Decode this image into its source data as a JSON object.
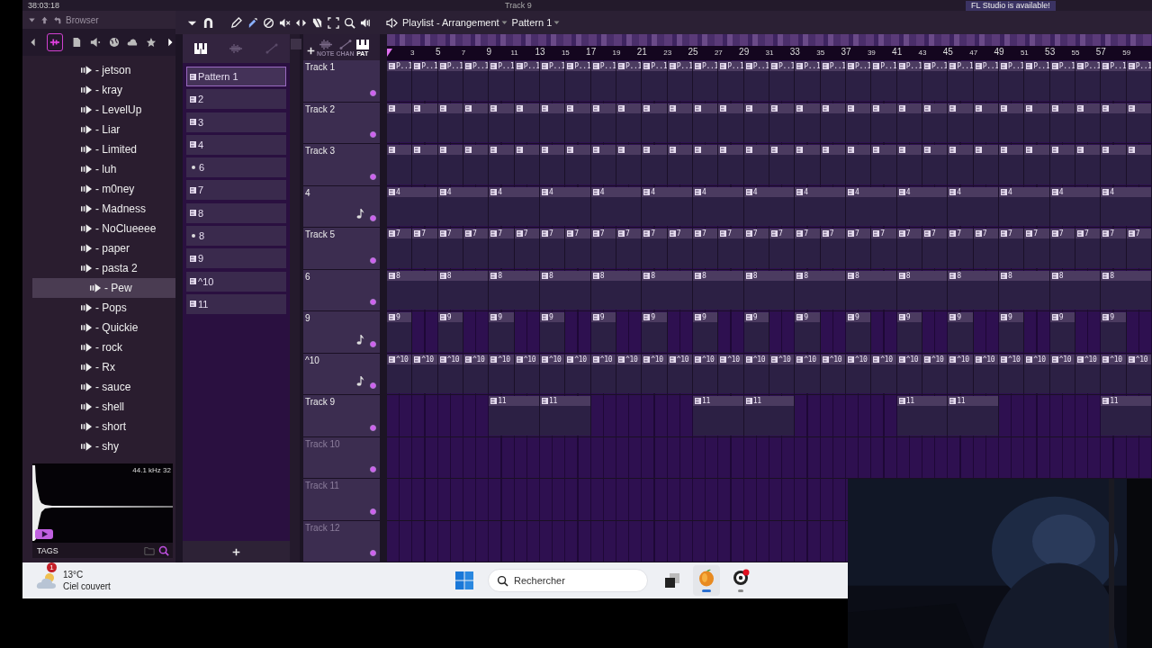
{
  "top_bar": {
    "time": "38:03:18",
    "track": "Track 9",
    "notice": "FL Studio is available!"
  },
  "browser": {
    "title": "Browser",
    "items": [
      {
        "label": "- jetson",
        "selected": false
      },
      {
        "label": "- kray",
        "selected": false
      },
      {
        "label": "- LevelUp",
        "selected": false
      },
      {
        "label": "- Liar",
        "selected": false
      },
      {
        "label": "- Limited",
        "selected": false
      },
      {
        "label": "- luh",
        "selected": false
      },
      {
        "label": "- m0ney",
        "selected": false
      },
      {
        "label": "- Madness",
        "selected": false
      },
      {
        "label": "- NoClueeee",
        "selected": false
      },
      {
        "label": "- paper",
        "selected": false
      },
      {
        "label": "- pasta 2",
        "selected": false
      },
      {
        "label": "- Pew",
        "selected": true
      },
      {
        "label": "- Pops",
        "selected": false
      },
      {
        "label": "- Quickie",
        "selected": false
      },
      {
        "label": "- rock",
        "selected": false
      },
      {
        "label": "- Rx",
        "selected": false
      },
      {
        "label": "- sauce",
        "selected": false
      },
      {
        "label": "- shell",
        "selected": false
      },
      {
        "label": "- short",
        "selected": false
      },
      {
        "label": "- shy",
        "selected": false
      }
    ],
    "preview": {
      "info": "44.1 kHz 32"
    },
    "tags_label": "TAGS"
  },
  "playlist": {
    "title": "Playlist - Arrangement",
    "pattern": "Pattern 1",
    "header_labels": [
      "NOTE",
      "CHAN",
      "PAT"
    ],
    "patterns": [
      {
        "label": "Pattern 1",
        "kind": "pattern",
        "selected": true
      },
      {
        "label": "2",
        "kind": "pattern",
        "selected": false
      },
      {
        "label": "3",
        "kind": "pattern",
        "selected": false
      },
      {
        "label": "4",
        "kind": "pattern",
        "selected": false
      },
      {
        "label": "6",
        "kind": "audio",
        "selected": false
      },
      {
        "label": "7",
        "kind": "pattern",
        "selected": false
      },
      {
        "label": "8",
        "kind": "pattern",
        "selected": false
      },
      {
        "label": "8",
        "kind": "audio",
        "selected": false
      },
      {
        "label": "9",
        "kind": "pattern",
        "selected": false
      },
      {
        "label": "^10",
        "kind": "pattern",
        "selected": false
      },
      {
        "label": "11",
        "kind": "pattern",
        "selected": false
      }
    ],
    "ruler": [
      "3",
      "5",
      "7",
      "9",
      "11",
      "13",
      "15",
      "17",
      "19",
      "21",
      "23",
      "25",
      "27",
      "29",
      "31",
      "33",
      "35",
      "37",
      "39",
      "41",
      "43",
      "45",
      "47",
      "49",
      "51",
      "53",
      "55",
      "57",
      "59"
    ],
    "tracks": [
      {
        "name": "Track 1",
        "kind": "plain",
        "dimmed": false,
        "clips": [
          {
            "kind": "pattern",
            "label": "P..1"
          },
          {
            "kind": "pattern",
            "label": "P..1"
          },
          {
            "kind": "pattern",
            "label": "P..1"
          },
          {
            "kind": "pattern",
            "label": "P..1"
          },
          {
            "kind": "pattern",
            "label": "P..1"
          },
          {
            "kind": "pattern",
            "label": "P..1"
          },
          {
            "kind": "pattern",
            "label": "P..1"
          },
          {
            "kind": "pattern",
            "label": "P..1"
          },
          {
            "kind": "pattern",
            "label": "P..1"
          },
          {
            "kind": "pattern",
            "label": "P..1"
          },
          {
            "kind": "pattern",
            "label": "P..1"
          },
          {
            "kind": "pattern",
            "label": "P..1"
          },
          {
            "kind": "pattern",
            "label": "P..1"
          },
          {
            "kind": "pattern",
            "label": "P..1"
          },
          {
            "kind": "pattern",
            "label": "P..1"
          },
          {
            "kind": "pattern",
            "label": "P..1"
          },
          {
            "kind": "pattern",
            "label": "P..1"
          },
          {
            "kind": "pattern",
            "label": "P..1"
          },
          {
            "kind": "pattern",
            "label": "P..1"
          },
          {
            "kind": "pattern",
            "label": "P..1"
          },
          {
            "kind": "pattern",
            "label": "P..1"
          },
          {
            "kind": "pattern",
            "label": "P..1"
          },
          {
            "kind": "pattern",
            "label": "P..1"
          },
          {
            "kind": "pattern",
            "label": "P..1"
          },
          {
            "kind": "pattern",
            "label": "P..1"
          },
          {
            "kind": "pattern",
            "label": "P..1"
          },
          {
            "kind": "pattern",
            "label": "P..1"
          },
          {
            "kind": "pattern",
            "label": "P..1"
          },
          {
            "kind": "pattern",
            "label": "P..1"
          },
          {
            "kind": "pattern",
            "label": "P..1"
          }
        ]
      },
      {
        "name": "Track 2",
        "kind": "plain",
        "dimmed": false,
        "clips": [
          {
            "kind": "pattern"
          },
          {
            "kind": "pattern"
          },
          {
            "kind": "pattern"
          },
          {
            "kind": "pattern"
          },
          {
            "kind": "pattern"
          },
          {
            "kind": "pattern"
          },
          {
            "kind": "pattern"
          },
          {
            "kind": "pattern"
          },
          {
            "kind": "pattern"
          },
          {
            "kind": "pattern"
          },
          {
            "kind": "pattern"
          },
          {
            "kind": "pattern"
          },
          {
            "kind": "pattern"
          },
          {
            "kind": "pattern"
          },
          {
            "kind": "pattern"
          },
          {
            "kind": "pattern"
          },
          {
            "kind": "pattern"
          },
          {
            "kind": "pattern"
          },
          {
            "kind": "pattern"
          },
          {
            "kind": "pattern"
          },
          {
            "kind": "pattern"
          },
          {
            "kind": "pattern"
          },
          {
            "kind": "pattern"
          },
          {
            "kind": "pattern"
          },
          {
            "kind": "pattern"
          },
          {
            "kind": "pattern"
          },
          {
            "kind": "pattern"
          },
          {
            "kind": "pattern"
          },
          {
            "kind": "pattern"
          },
          {
            "kind": "pattern"
          }
        ]
      },
      {
        "name": "Track 3",
        "kind": "plain",
        "dimmed": false,
        "clips": [
          {
            "kind": "pattern"
          },
          {
            "kind": "pattern"
          },
          {
            "kind": "pattern"
          },
          {
            "kind": "pattern"
          },
          {
            "kind": "pattern"
          },
          {
            "kind": "pattern"
          },
          {
            "kind": "pattern"
          },
          {
            "kind": "pattern"
          },
          {
            "kind": "pattern"
          },
          {
            "kind": "pattern"
          },
          {
            "kind": "pattern"
          },
          {
            "kind": "pattern"
          },
          {
            "kind": "pattern"
          },
          {
            "kind": "pattern"
          },
          {
            "kind": "pattern"
          },
          {
            "kind": "pattern"
          },
          {
            "kind": "pattern"
          },
          {
            "kind": "pattern"
          },
          {
            "kind": "pattern"
          },
          {
            "kind": "pattern"
          },
          {
            "kind": "pattern"
          },
          {
            "kind": "pattern"
          },
          {
            "kind": "pattern"
          },
          {
            "kind": "pattern"
          },
          {
            "kind": "pattern"
          },
          {
            "kind": "pattern"
          },
          {
            "kind": "pattern"
          },
          {
            "kind": "pattern"
          },
          {
            "kind": "pattern"
          },
          {
            "kind": "pattern"
          }
        ]
      },
      {
        "name": "4",
        "kind": "notes",
        "dimmed": false,
        "clips": [
          {
            "kind": "pattern",
            "label": "4"
          },
          {
            "kind": "pattern",
            "label": "4"
          },
          {
            "kind": "pattern",
            "label": "4"
          },
          {
            "kind": "pattern",
            "label": "4"
          },
          {
            "kind": "pattern",
            "label": "4"
          },
          {
            "kind": "pattern",
            "label": "4"
          },
          {
            "kind": "pattern",
            "label": "4"
          },
          {
            "kind": "pattern",
            "label": "4"
          },
          {
            "kind": "pattern",
            "label": "4"
          },
          {
            "kind": "pattern",
            "label": "4"
          },
          {
            "kind": "pattern",
            "label": "4"
          },
          {
            "kind": "pattern",
            "label": "4"
          },
          {
            "kind": "pattern",
            "label": "4"
          },
          {
            "kind": "pattern",
            "label": "4"
          },
          {
            "kind": "pattern",
            "label": "4"
          }
        ]
      },
      {
        "name": "Track 5",
        "kind": "plain",
        "dimmed": false,
        "clips": [
          {
            "kind": "pattern",
            "label": "7"
          },
          {
            "kind": "pattern",
            "label": "7"
          },
          {
            "kind": "pattern",
            "label": "7"
          },
          {
            "kind": "pattern",
            "label": "7"
          },
          {
            "kind": "pattern",
            "label": "7"
          },
          {
            "kind": "pattern",
            "label": "7"
          },
          {
            "kind": "pattern",
            "label": "7"
          },
          {
            "kind": "pattern",
            "label": "7"
          },
          {
            "kind": "pattern",
            "label": "7"
          },
          {
            "kind": "pattern",
            "label": "7"
          },
          {
            "kind": "pattern",
            "label": "7"
          },
          {
            "kind": "pattern",
            "label": "7"
          },
          {
            "kind": "pattern",
            "label": "7"
          },
          {
            "kind": "pattern",
            "label": "7"
          },
          {
            "kind": "pattern",
            "label": "7"
          },
          {
            "kind": "pattern",
            "label": "7"
          },
          {
            "kind": "pattern",
            "label": "7"
          },
          {
            "kind": "pattern",
            "label": "7"
          },
          {
            "kind": "pattern",
            "label": "7"
          },
          {
            "kind": "pattern",
            "label": "7"
          },
          {
            "kind": "pattern",
            "label": "7"
          },
          {
            "kind": "pattern",
            "label": "7"
          },
          {
            "kind": "pattern",
            "label": "7"
          },
          {
            "kind": "pattern",
            "label": "7"
          },
          {
            "kind": "pattern",
            "label": "7"
          },
          {
            "kind": "pattern",
            "label": "7"
          },
          {
            "kind": "pattern",
            "label": "7"
          },
          {
            "kind": "pattern",
            "label": "7"
          },
          {
            "kind": "pattern",
            "label": "7"
          },
          {
            "kind": "pattern",
            "label": "7"
          }
        ]
      },
      {
        "name": "6",
        "kind": "plain",
        "dimmed": false,
        "clips": [
          {
            "kind": "pattern",
            "label": "8"
          },
          {
            "kind": "pattern",
            "label": "8"
          },
          {
            "kind": "pattern",
            "label": "8"
          },
          {
            "kind": "pattern",
            "label": "8"
          },
          {
            "kind": "pattern",
            "label": "8"
          },
          {
            "kind": "pattern",
            "label": "8"
          },
          {
            "kind": "pattern",
            "label": "8"
          },
          {
            "kind": "pattern",
            "label": "8"
          },
          {
            "kind": "pattern",
            "label": "8"
          },
          {
            "kind": "pattern",
            "label": "8"
          },
          {
            "kind": "pattern",
            "label": "8"
          },
          {
            "kind": "pattern",
            "label": "8"
          },
          {
            "kind": "pattern",
            "label": "8"
          },
          {
            "kind": "pattern",
            "label": "8"
          },
          {
            "kind": "pattern",
            "label": "8"
          }
        ]
      },
      {
        "name": "9",
        "kind": "notes",
        "dimmed": false,
        "clips": [
          {
            "kind": "pattern",
            "label": "9"
          },
          {
            "kind": "pattern",
            "label": "9"
          },
          {
            "kind": "pattern",
            "label": "9"
          },
          {
            "kind": "pattern",
            "label": "9"
          },
          {
            "kind": "pattern",
            "label": "9"
          },
          {
            "kind": "pattern",
            "label": "9"
          },
          {
            "kind": "pattern",
            "label": "9"
          },
          {
            "kind": "pattern",
            "label": "9"
          },
          {
            "kind": "pattern",
            "label": "9"
          },
          {
            "kind": "pattern",
            "label": "9"
          },
          {
            "kind": "pattern",
            "label": "9"
          },
          {
            "kind": "pattern",
            "label": "9"
          },
          {
            "kind": "pattern",
            "label": "9"
          },
          {
            "kind": "pattern",
            "label": "9"
          },
          {
            "kind": "pattern",
            "label": "9"
          }
        ]
      },
      {
        "name": "^10",
        "kind": "notes",
        "dimmed": false,
        "clips": [
          {
            "kind": "pattern",
            "label": "^10"
          },
          {
            "kind": "pattern",
            "label": "^10"
          },
          {
            "kind": "pattern",
            "label": "^10"
          },
          {
            "kind": "pattern",
            "label": "^10"
          },
          {
            "kind": "pattern",
            "label": "^10"
          },
          {
            "kind": "pattern",
            "label": "^10"
          },
          {
            "kind": "pattern",
            "label": "^10"
          },
          {
            "kind": "pattern",
            "label": "^10"
          },
          {
            "kind": "pattern",
            "label": "^10"
          },
          {
            "kind": "pattern",
            "label": "^10"
          },
          {
            "kind": "pattern",
            "label": "^10"
          },
          {
            "kind": "pattern",
            "label": "^10"
          },
          {
            "kind": "pattern",
            "label": "^10"
          },
          {
            "kind": "pattern",
            "label": "^10"
          },
          {
            "kind": "pattern",
            "label": "^10"
          },
          {
            "kind": "pattern",
            "label": "^10"
          },
          {
            "kind": "pattern",
            "label": "^10"
          },
          {
            "kind": "pattern",
            "label": "^10"
          },
          {
            "kind": "pattern",
            "label": "^10"
          },
          {
            "kind": "pattern",
            "label": "^10"
          },
          {
            "kind": "pattern",
            "label": "^10"
          },
          {
            "kind": "pattern",
            "label": "^10"
          },
          {
            "kind": "pattern",
            "label": "^10"
          },
          {
            "kind": "pattern",
            "label": "^10"
          },
          {
            "kind": "pattern",
            "label": "^10"
          },
          {
            "kind": "pattern",
            "label": "^10"
          },
          {
            "kind": "pattern",
            "label": "^10"
          },
          {
            "kind": "pattern",
            "label": "^10"
          },
          {
            "kind": "pattern",
            "label": "^10"
          },
          {
            "kind": "pattern",
            "label": "^10"
          }
        ]
      },
      {
        "name": "Track 9",
        "kind": "plain",
        "dimmed": false,
        "clips": [
          {
            "kind": "pattern",
            "label": "11"
          },
          {
            "kind": "pattern",
            "label": "11"
          },
          {
            "kind": "pattern",
            "label": "11"
          },
          {
            "kind": "pattern",
            "label": "11"
          },
          {
            "kind": "pattern",
            "label": "11"
          },
          {
            "kind": "pattern",
            "label": "11"
          },
          {
            "kind": "pattern",
            "label": "11"
          }
        ]
      },
      {
        "name": "Track 10",
        "kind": "plain",
        "dimmed": true
      },
      {
        "name": "Track 11",
        "kind": "plain",
        "dimmed": true
      },
      {
        "name": "Track 12",
        "kind": "plain",
        "dimmed": true
      }
    ]
  },
  "taskbar": {
    "badge": "1",
    "temperature": "13°C",
    "weather": "Ciel couvert",
    "search_placeholder": "Rechercher"
  }
}
